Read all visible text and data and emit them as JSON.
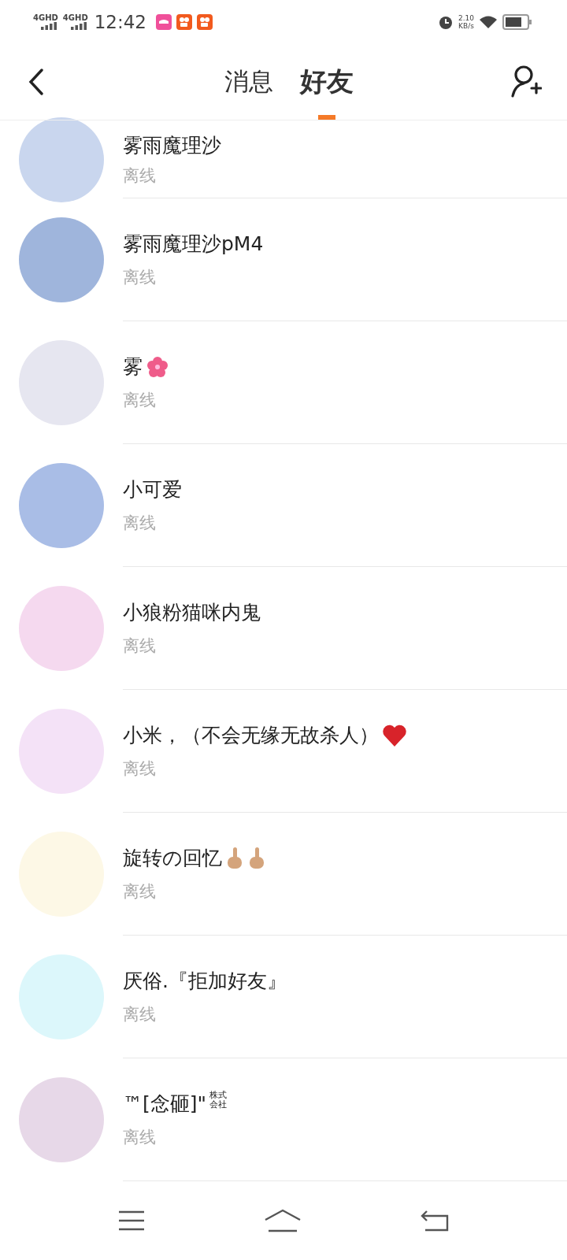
{
  "status_bar": {
    "network_1": "4GHD",
    "network_2": "4GHD",
    "time": "12:42",
    "speed": "2.10",
    "speed_unit": "KB/s"
  },
  "nav": {
    "tabs": [
      {
        "label": "消息",
        "selected": false
      },
      {
        "label": "好友",
        "selected": true
      }
    ]
  },
  "friends": [
    {
      "name": "雾雨魔理沙",
      "status": "离线",
      "color": "#c9d6ee",
      "cut": true
    },
    {
      "name": "雾雨魔理沙pM4",
      "status": "离线",
      "color": "#9fb5dc"
    },
    {
      "name": "雾",
      "status": "离线",
      "color": "#e6e6f0",
      "emoji": [
        {
          "kind": "flower"
        }
      ]
    },
    {
      "name": "小可爱",
      "status": "离线",
      "color": "#a9bde6"
    },
    {
      "name": "小狼粉猫咪内鬼",
      "status": "离线",
      "color": "#f5d9ef"
    },
    {
      "name": "小米，（不会无缘无故杀人）",
      "status": "离线",
      "color": "#f4e2f7",
      "emoji": [
        {
          "kind": "heart"
        }
      ]
    },
    {
      "name": "旋转の回忆",
      "status": "离线",
      "color": "#fdf8e6",
      "emoji": [
        {
          "kind": "finger"
        },
        {
          "kind": "finger"
        }
      ]
    },
    {
      "name": "厌俗.『拒加好友』",
      "status": "离线",
      "color": "#dcf7fb"
    },
    {
      "name": "™[念砸]\"",
      "suffix": "株式会社",
      "status": "离线",
      "color": "#e7d8e8"
    }
  ]
}
